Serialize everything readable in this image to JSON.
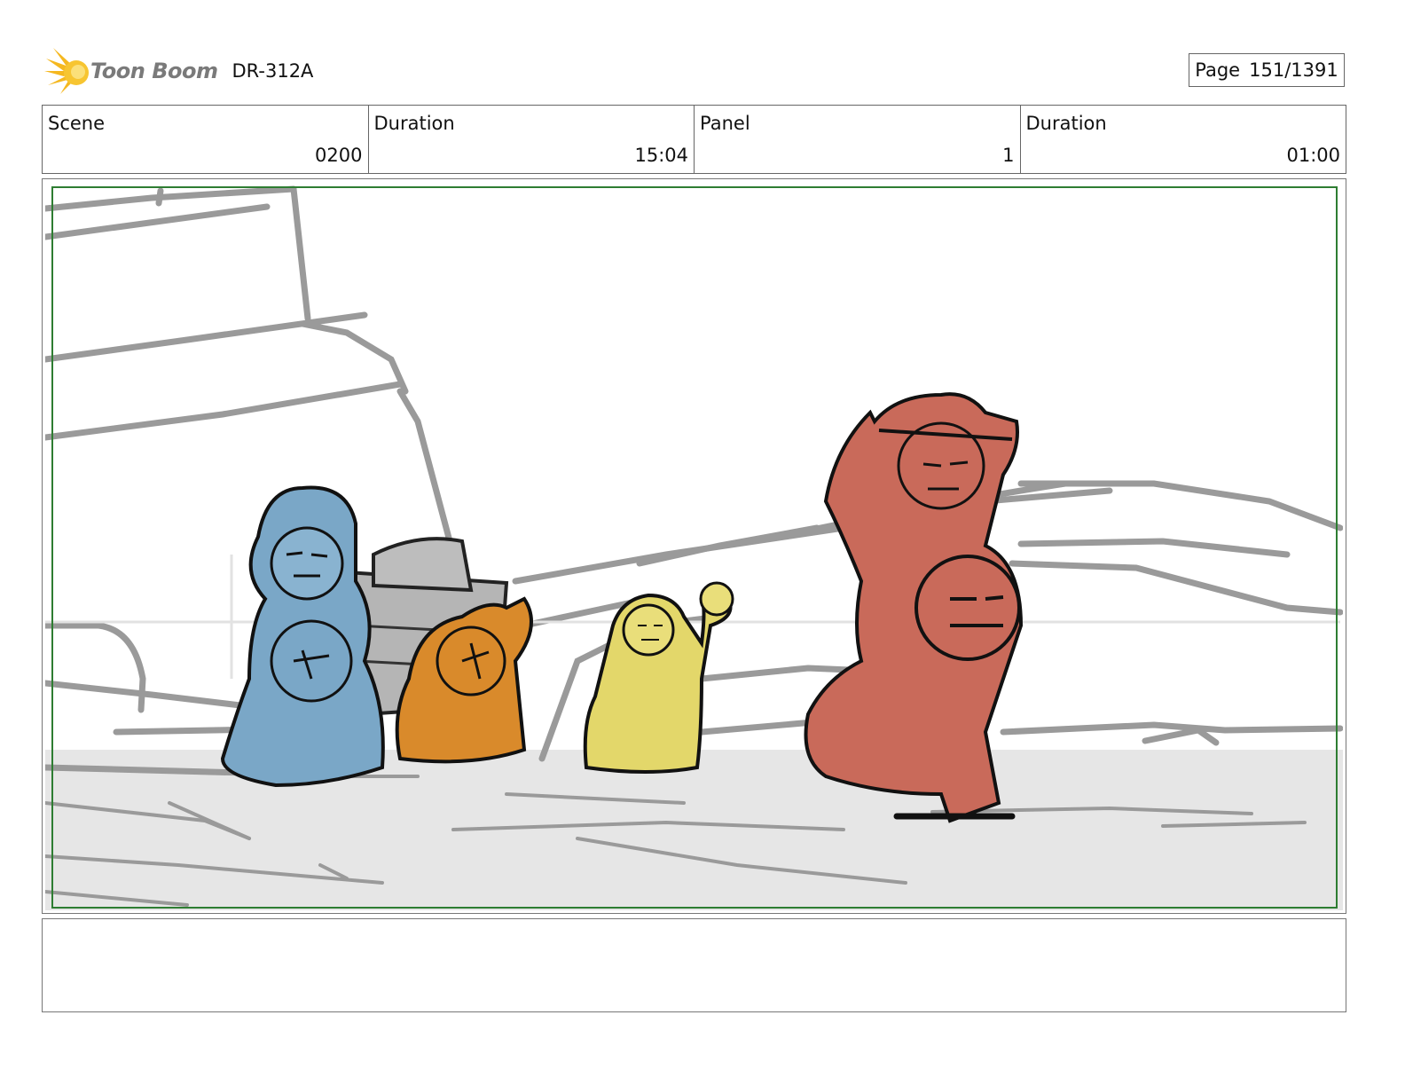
{
  "header": {
    "brand": "Toon Boom",
    "episode_code": "DR-312A",
    "page_label": "Page",
    "page_value": "151/1391"
  },
  "info": {
    "scene_label": "Scene",
    "scene_value": "0200",
    "scene_duration_label": "Duration",
    "scene_duration_value": "15:04",
    "panel_label": "Panel",
    "panel_value": "1",
    "panel_duration_label": "Duration",
    "panel_duration_value": "01:00"
  },
  "colors": {
    "frame_border": "#2e7d32",
    "character_blue": "#7aa7c7",
    "character_orange": "#d98a2b",
    "character_yellow": "#e3d76a",
    "character_red": "#c96a5a",
    "background_lines": "#9a9a9a",
    "ground": "#e3e3e3"
  },
  "icons": {
    "logo": "toon-boom-star-icon"
  },
  "notes": {
    "text": ""
  }
}
